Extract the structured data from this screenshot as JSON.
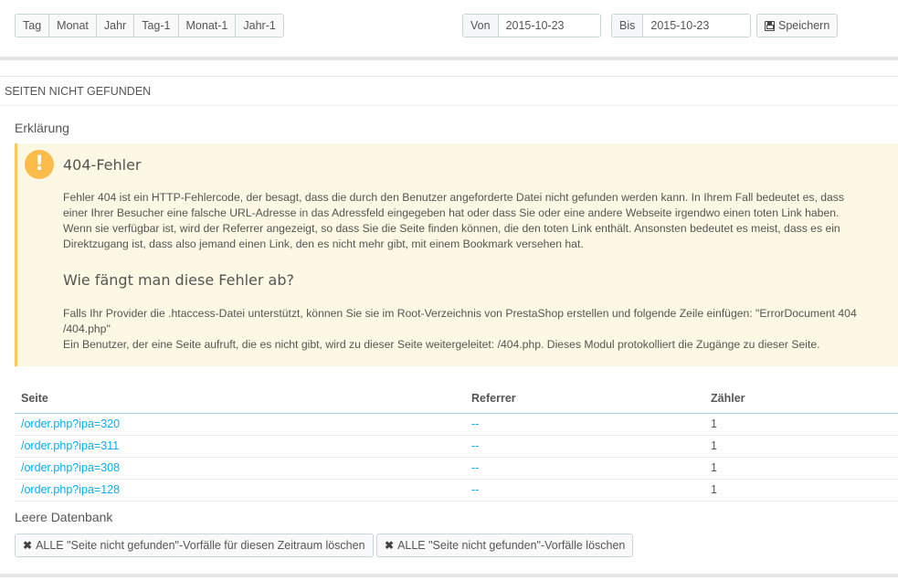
{
  "toolbar": {
    "periods": [
      "Tag",
      "Monat",
      "Jahr",
      "Tag-1",
      "Monat-1",
      "Jahr-1"
    ],
    "from_label": "Von",
    "from_value": "2015-10-23",
    "to_label": "Bis",
    "to_value": "2015-10-23",
    "save_label": "Speichern"
  },
  "panel": {
    "heading": "SEITEN NICHT GEFUNDEN",
    "explanation_title": "Erklärung",
    "alert": {
      "title1": "404-Fehler",
      "text1": "Fehler 404 ist ein HTTP-Fehlercode, der besagt, dass die durch den Benutzer angeforderte Datei nicht gefunden werden kann. In Ihrem Fall bedeutet es, dass einer Ihrer Besucher eine falsche URL-Adresse in das Adressfeld eingegeben hat oder dass Sie oder eine andere Webseite irgendwo einen toten Link haben. Wenn sie verfügbar ist, wird der Referrer angezeigt, so dass Sie die Seite finden können, die den toten Link enthält. Ansonsten bedeutet es meist, dass es ein Direktzugang ist, dass also jemand einen Link, den es nicht mehr gibt, mit einem Bookmark versehen hat.",
      "title2": "Wie fängt man diese Fehler ab?",
      "text2a": "Falls Ihr Provider die .htaccess-Datei unterstützt, können Sie sie im Root-Verzeichnis von PrestaShop erstellen und folgende Zeile einfügen: \"ErrorDocument 404 /404.php\"",
      "text2b": "Ein Benutzer, der eine Seite aufruft, die es nicht gibt, wird zu dieser Seite weitergeleitet: /404.php. Dieses Modul protokolliert die Zugänge zu dieser Seite."
    },
    "table": {
      "headers": [
        "Seite",
        "Referrer",
        "Zähler"
      ],
      "rows": [
        {
          "page": "/order.php?ipa=320",
          "referrer": "--",
          "count": "1"
        },
        {
          "page": "/order.php?ipa=311",
          "referrer": "--",
          "count": "1"
        },
        {
          "page": "/order.php?ipa=308",
          "referrer": "--",
          "count": "1"
        },
        {
          "page": "/order.php?ipa=128",
          "referrer": "--",
          "count": "1"
        }
      ]
    },
    "empty_db_title": "Leere Datenbank",
    "delete_period_label": "ALLE \"Seite nicht gefunden\"-Vorfälle für diesen Zeitraum löschen",
    "delete_all_label": "ALLE \"Seite nicht gefunden\"-Vorfälle löschen"
  }
}
